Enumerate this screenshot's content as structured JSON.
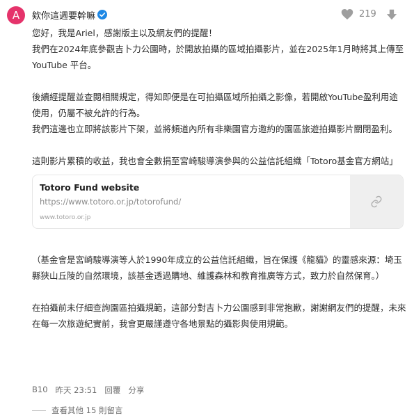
{
  "comment": {
    "avatar_letter": "A",
    "avatar_color": "#e5336b",
    "author": "欸你這週要幹嘛",
    "verified_color": "#1e88e5",
    "like_count": "219",
    "paragraphs": [
      "您好，我是Ariel，感謝版主以及網友們的提醒！",
      "我們在2024年底參觀吉卜力公園時，於開放拍攝的區域拍攝影片，並在2025年1月時將其上傳至 YouTube 平台。",
      "後續經提醒並查閱相關規定，得知即便是在可拍攝區域所拍攝之影像，若開啟YouTube盈利用途使用，仍屬不被允許的行為。",
      "我們這邊也立即將該影片下架，並將頻道內所有非樂園官方邀約的園區旅遊拍攝影片關閉盈利。",
      "這則影片累積的收益，我也會全數捐至宮崎駿導演參與的公益信託組織「Totoro基金官方網站」",
      "（基金會是宮崎駿導演等人於1990年成立的公益信託組織，旨在保護《龍貓》的靈感來源：埼玉縣狹山丘陵的自然環境，該基金透過購地、維護森林和教育推廣等方式，致力於自然保育。）",
      "在拍攝前未仔細查詢園區拍攝規範，這部分對吉卜力公園感到非常抱歉，謝謝網友們的提醒，未來在每一次旅遊紀實前，我會更嚴謹遵守各地景點的攝影與使用規範。"
    ],
    "link_card": {
      "title": "Totoro Fund website",
      "url": "https://www.totoro.or.jp/totorofund/",
      "domain": "www.totoro.or.jp"
    },
    "floor": "B10",
    "time": "昨天 23:51",
    "reply_label": "回覆",
    "share_label": "分享",
    "more_replies": "查看其他 15 則留言"
  }
}
